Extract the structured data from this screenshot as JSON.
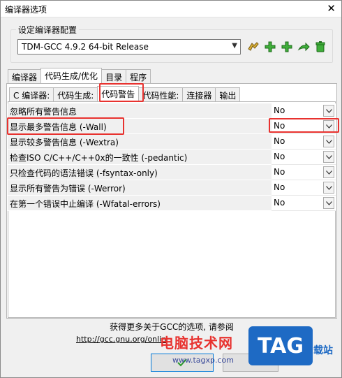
{
  "window": {
    "title": "编译器选项",
    "close_glyph": "✕"
  },
  "compiler_config": {
    "label": "设定编译器配置",
    "selected": "TDM-GCC 4.9.2 64-bit Release",
    "toolbar_icons": [
      "edit-icon",
      "add-icon",
      "add-copy-icon",
      "rename-icon",
      "delete-icon"
    ]
  },
  "main_tabs": [
    {
      "label": "编译器",
      "selected": false
    },
    {
      "label": "代码生成/优化",
      "selected": true
    },
    {
      "label": "目录",
      "selected": false
    },
    {
      "label": "程序",
      "selected": false
    }
  ],
  "sub_tabs": [
    {
      "label": "C 编译器:",
      "selected": false
    },
    {
      "label": "代码生成:",
      "selected": false
    },
    {
      "label": "代码警告",
      "selected": true
    },
    {
      "label": "代码性能:",
      "selected": false
    },
    {
      "label": "连接器",
      "selected": false
    },
    {
      "label": "输出",
      "selected": false
    }
  ],
  "options": [
    {
      "label": "忽略所有警告信息",
      "value": "No"
    },
    {
      "label": "显示最多警告信息 (-Wall)",
      "value": "No"
    },
    {
      "label": "显示较多警告信息 (-Wextra)",
      "value": "No"
    },
    {
      "label": "检查ISO C/C++/C++0x的一致性 (-pedantic)",
      "value": "No"
    },
    {
      "label": "只检查代码的语法错误 (-fsyntax-only)",
      "value": "No"
    },
    {
      "label": "显示所有警告为错误 (-Werror)",
      "value": "No"
    },
    {
      "label": "在第一个错误中止编译 (-Wfatal-errors)",
      "value": "No"
    }
  ],
  "footer": {
    "more_info": "获得更多关于GCC的选项, 请参阅",
    "link": "http://gcc.gnu.org/onlin"
  },
  "watermark": {
    "text": "电脑技术网",
    "url": "www.tagxp.com",
    "badge": "TAG",
    "side": "载站"
  },
  "colors": {
    "highlight": "#e8322f",
    "tab_selected": "#ffffff",
    "watermark_blue": "#1e6ac4"
  }
}
